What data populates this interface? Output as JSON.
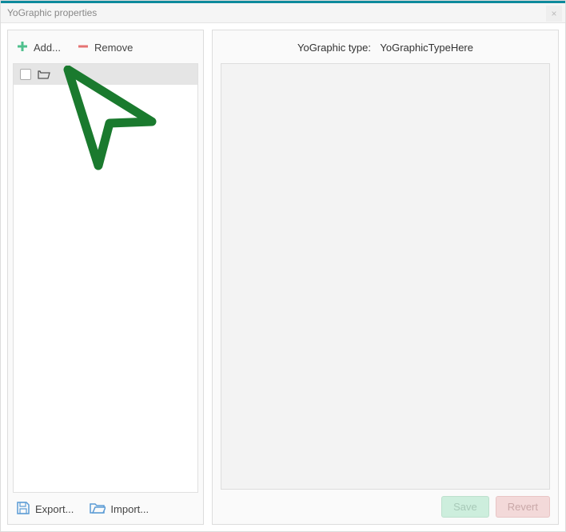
{
  "window": {
    "title": "YoGraphic properties"
  },
  "left": {
    "add_label": "Add...",
    "remove_label": "Remove",
    "export_label": "Export...",
    "import_label": "Import...",
    "items": [
      {
        "label": ""
      }
    ]
  },
  "right": {
    "type_label": "YoGraphic type:",
    "type_value": "YoGraphicTypeHere",
    "save_label": "Save",
    "revert_label": "Revert"
  },
  "colors": {
    "accent": "#0d8a9c",
    "add_icon": "#4fc08d",
    "remove_icon": "#e57373",
    "io_icon": "#5b9bd5",
    "cursor": "#1a7a2e"
  }
}
